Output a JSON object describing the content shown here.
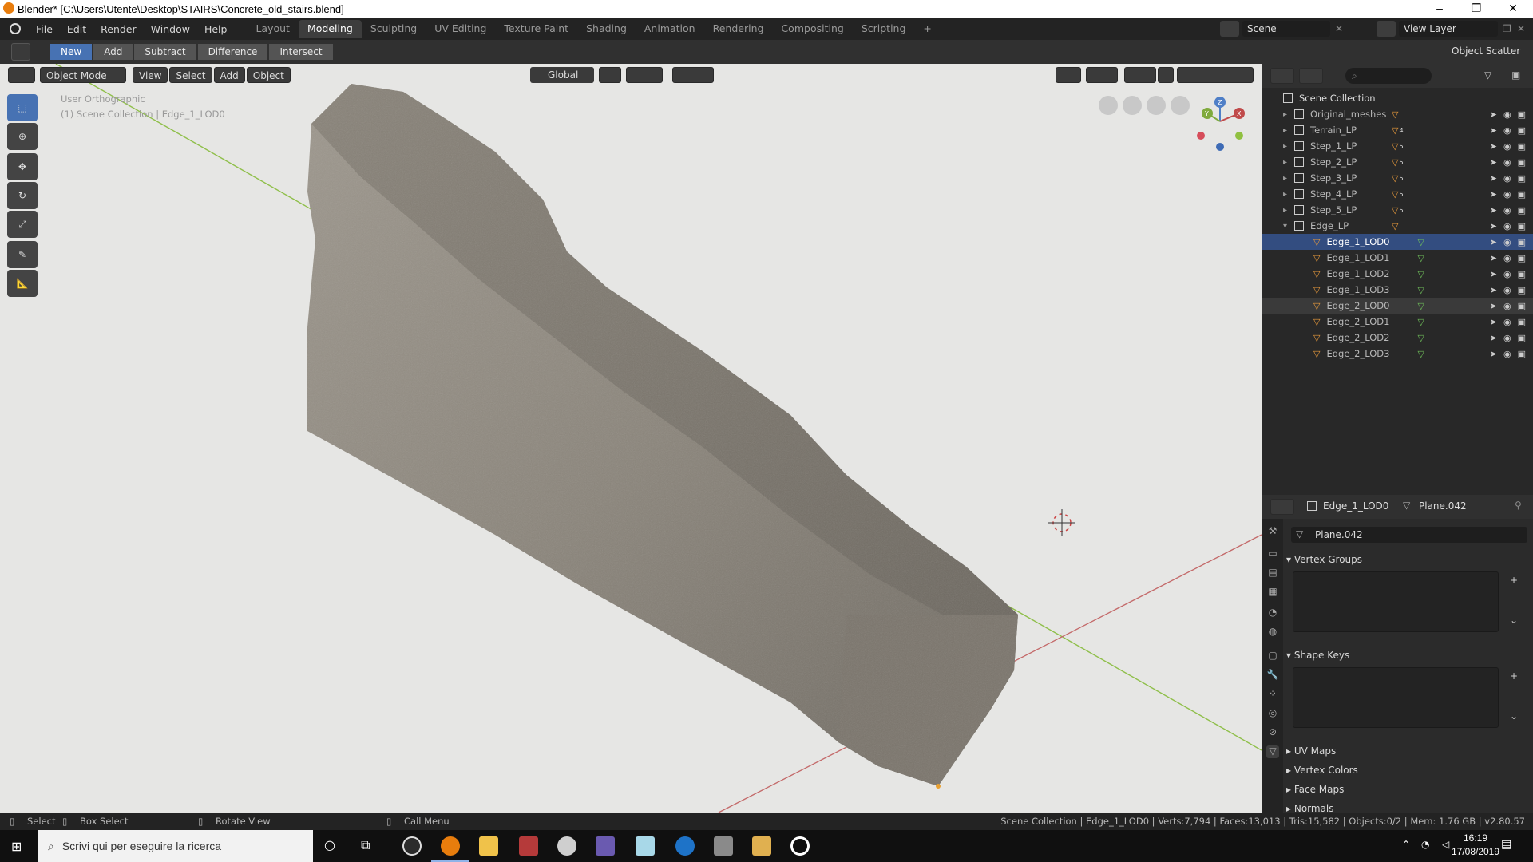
{
  "window": {
    "title": "Blender* [C:\\Users\\Utente\\Desktop\\STAIRS\\Concrete_old_stairs.blend]",
    "minimize": "–",
    "maximize": "❐",
    "close": "✕"
  },
  "menu": [
    "File",
    "Edit",
    "Render",
    "Window",
    "Help"
  ],
  "workspaces": [
    "Layout",
    "Modeling",
    "Sculpting",
    "UV Editing",
    "Texture Paint",
    "Shading",
    "Animation",
    "Rendering",
    "Compositing",
    "Scripting",
    "+"
  ],
  "active_workspace": "Modeling",
  "scene": {
    "label": "Scene",
    "view_layer": "View Layer"
  },
  "toolbar": {
    "buttons": [
      "New",
      "Add",
      "Subtract",
      "Difference",
      "Intersect"
    ],
    "active": "New",
    "right_label": "Object Scatter"
  },
  "viewport": {
    "mode": "Object Mode",
    "menus": [
      "View",
      "Select",
      "Add",
      "Object"
    ],
    "orientation": "Global",
    "overlay_title": "User Orthographic",
    "overlay_sub": "(1) Scene Collection | Edge_1_LOD0",
    "gizmo_axes": [
      "Z",
      "Y",
      "X"
    ],
    "colors": {
      "bg": "#e6e6e4",
      "x_axis": "#c46a6a",
      "y_axis": "#8fbf4a",
      "rock": "#8c877f"
    }
  },
  "tools": [
    "select-box",
    "cursor",
    "move",
    "rotate",
    "scale",
    "annotate",
    "measure"
  ],
  "outliner": {
    "search_placeholder": "",
    "root": "Scene Collection",
    "rows": [
      {
        "label": "Original_meshes",
        "type": "collection",
        "badge": ""
      },
      {
        "label": "Terrain_LP",
        "type": "collection",
        "badge": "4"
      },
      {
        "label": "Step_1_LP",
        "type": "collection",
        "badge": "5"
      },
      {
        "label": "Step_2_LP",
        "type": "collection",
        "badge": "5"
      },
      {
        "label": "Step_3_LP",
        "type": "collection",
        "badge": "5"
      },
      {
        "label": "Step_4_LP",
        "type": "collection",
        "badge": "5"
      },
      {
        "label": "Step_5_LP",
        "type": "collection",
        "badge": "5"
      },
      {
        "label": "Edge_LP",
        "type": "collection",
        "badge": ""
      },
      {
        "label": "Edge_1_LOD0",
        "type": "mesh",
        "badge": ""
      },
      {
        "label": "Edge_1_LOD1",
        "type": "mesh",
        "badge": ""
      },
      {
        "label": "Edge_1_LOD2",
        "type": "mesh",
        "badge": ""
      },
      {
        "label": "Edge_1_LOD3",
        "type": "mesh",
        "badge": ""
      },
      {
        "label": "Edge_2_LOD0",
        "type": "mesh",
        "badge": ""
      },
      {
        "label": "Edge_2_LOD1",
        "type": "mesh",
        "badge": ""
      },
      {
        "label": "Edge_2_LOD2",
        "type": "mesh",
        "badge": ""
      },
      {
        "label": "Edge_2_LOD3",
        "type": "mesh",
        "badge": ""
      }
    ]
  },
  "properties": {
    "object": "Edge_1_LOD0",
    "data": "Plane.042",
    "mesh_name": "Plane.042",
    "panels": [
      "Vertex Groups",
      "Shape Keys",
      "UV Maps",
      "Vertex Colors",
      "Face Maps",
      "Normals"
    ]
  },
  "statusbar": {
    "select": "Select",
    "box_select": "Box Select",
    "rotate_view": "Rotate View",
    "call_menu": "Call Menu",
    "stats": "Scene Collection | Edge_1_LOD0 | Verts:7,794 | Faces:13,013 | Tris:15,582 | Objects:0/2 | Mem: 1.76 GB | v2.80.57"
  },
  "taskbar": {
    "search_placeholder": "Scrivi qui per eseguire la ricerca",
    "time": "16:19",
    "date": "17/08/2019"
  }
}
